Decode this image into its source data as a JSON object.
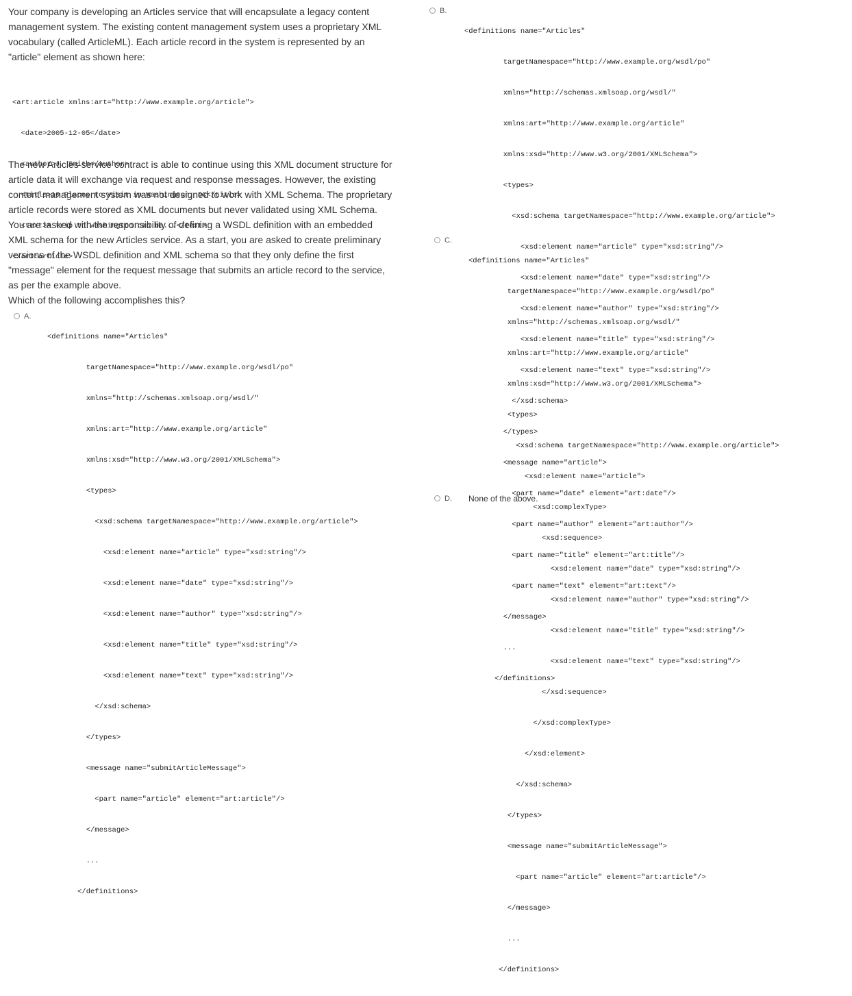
{
  "question": {
    "intro_lines": [
      "Your company is developing an Articles service that will encapsulate a legacy content",
      "management system. The existing content management system uses a proprietary XML",
      "vocabulary (called ArticleML). Each article record in the system is represented by an",
      "\"article\" element as shown here:"
    ],
    "example_code": [
      "<art:article xmlns:art=\"http://www.example.org/article\">",
      "  <date>2005-12-05</date>",
      "  <author>J. Smith</author>",
      "  <title>10 Places to Visit in Washington, DC</title>",
      "  <text>A trip to Washington can be...</text>",
      "</art:article>"
    ],
    "body_lines": [
      "The new Articles service contract is able to continue using this XML document structure for",
      "article data it will exchange via request and response messages. However, the existing",
      "content management system was not designed to work with XML Schema. The proprietary",
      "article records were stored as XML documents but never validated using XML Schema.",
      "You are tasked with the responsibility of defining a WSDL definition with an embedded",
      "XML schema for the new Articles service. As a start, you are asked to create preliminary",
      "versions of the WSDL definition and XML schema so that they only define the first",
      "\"message\" element for the request message that submits an article record to the service,",
      "as per the example above.",
      "Which of the following accomplishes this?"
    ]
  },
  "options": {
    "a": {
      "letter": "A.",
      "code": [
        "<definitions name=\"Articles\"",
        "         targetNamespace=\"http://www.example.org/wsdl/po\"",
        "         xmlns=\"http://schemas.xmlsoap.org/wsdl/\"",
        "         xmlns:art=\"http://www.example.org/article\"",
        "         xmlns:xsd=\"http://www.w3.org/2001/XMLSchema\">",
        "         <types>",
        "           <xsd:schema targetNamespace=\"http://www.example.org/article\">",
        "             <xsd:element name=\"article\" type=\"xsd:string\"/>",
        "             <xsd:element name=\"date\" type=\"xsd:string\"/>",
        "             <xsd:element name=\"author\" type=\"xsd:string\"/>",
        "             <xsd:element name=\"title\" type=\"xsd:string\"/>",
        "             <xsd:element name=\"text\" type=\"xsd:string\"/>",
        "           </xsd:schema>",
        "         </types>",
        "         <message name=\"submitArticleMessage\">",
        "           <part name=\"article\" element=\"art:article\"/>",
        "         </message>",
        "         ...",
        "       </definitions>"
      ]
    },
    "b": {
      "letter": "B.",
      "code": [
        "<definitions name=\"Articles\"",
        "         targetNamespace=\"http://www.example.org/wsdl/po\"",
        "         xmlns=\"http://schemas.xmlsoap.org/wsdl/\"",
        "         xmlns:art=\"http://www.example.org/article\"",
        "         xmlns:xsd=\"http://www.w3.org/2001/XMLSchema\">",
        "         <types>",
        "           <xsd:schema targetNamespace=\"http://www.example.org/article\">",
        "             <xsd:element name=\"article\" type=\"xsd:string\"/>",
        "             <xsd:element name=\"date\" type=\"xsd:string\"/>",
        "             <xsd:element name=\"author\" type=\"xsd:string\"/>",
        "             <xsd:element name=\"title\" type=\"xsd:string\"/>",
        "             <xsd:element name=\"text\" type=\"xsd:string\"/>",
        "           </xsd:schema>",
        "         </types>",
        "         <message name=\"article\">",
        "           <part name=\"date\" element=\"art:date\"/>",
        "           <part name=\"author\" element=\"art:author\"/>",
        "           <part name=\"title\" element=\"art:title\"/>",
        "           <part name=\"text\" element=\"art:text\"/>",
        "         </message>",
        "         ...",
        "       </definitions>"
      ]
    },
    "c": {
      "letter": "C.",
      "code": [
        "<definitions name=\"Articles\"",
        "         targetNamespace=\"http://www.example.org/wsdl/po\"",
        "         xmlns=\"http://schemas.xmlsoap.org/wsdl/\"",
        "         xmlns:art=\"http://www.example.org/article\"",
        "         xmlns:xsd=\"http://www.w3.org/2001/XMLSchema\">",
        "         <types>",
        "           <xsd:schema targetNamespace=\"http://www.example.org/article\">",
        "             <xsd:element name=\"article\">",
        "               <xsd:complexType>",
        "                 <xsd:sequence>",
        "                   <xsd:element name=\"date\" type=\"xsd:string\"/>",
        "                   <xsd:element name=\"author\" type=\"xsd:string\"/>",
        "                   <xsd:element name=\"title\" type=\"xsd:string\"/>",
        "                   <xsd:element name=\"text\" type=\"xsd:string\"/>",
        "                 </xsd:sequence>",
        "               </xsd:complexType>",
        "             </xsd:element>",
        "           </xsd:schema>",
        "         </types>",
        "         <message name=\"submitArticleMessage\">",
        "           <part name=\"article\" element=\"art:article\"/>",
        "         </message>",
        "         ...",
        "       </definitions>"
      ]
    },
    "d": {
      "letter": "D.",
      "label": "None of the above."
    }
  }
}
